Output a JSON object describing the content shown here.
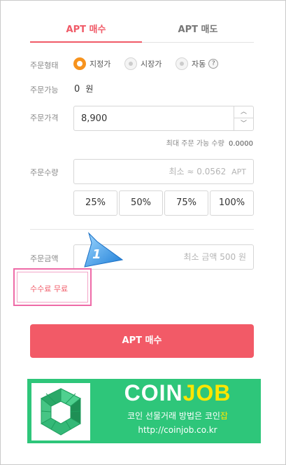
{
  "tabs": {
    "buy": "APT 매수",
    "sell": "APT 매도"
  },
  "order_type": {
    "label": "주문형태",
    "options": [
      "지정가",
      "시장가",
      "자동"
    ],
    "selected": "지정가",
    "help": "?"
  },
  "available": {
    "label": "주문가능",
    "value": "0",
    "unit": "원"
  },
  "price": {
    "label": "주문가격",
    "value": "8,900"
  },
  "max_qty": {
    "label": "최대 주문 가능 수량",
    "value": "0.0000"
  },
  "quantity": {
    "label": "주문수량",
    "placeholder": "최소 ≈ 0.0562",
    "unit": "APT"
  },
  "percent_buttons": [
    "25%",
    "50%",
    "75%",
    "100%"
  ],
  "amount": {
    "label": "주문금액",
    "placeholder": "최소 금액 500 원"
  },
  "fee": {
    "text": "수수료 무료"
  },
  "annotation": {
    "number": "1"
  },
  "buy_button": "APT 매수",
  "banner": {
    "title_part1": "COIN",
    "title_part2": "JOB",
    "subtitle_main": "코인 선물거래 방법은 코인",
    "subtitle_highlight": "잡",
    "url": "http://coinjob.co.kr"
  },
  "colors": {
    "accent": "#f05a67",
    "radio_selected": "#f7931e",
    "banner_bg": "#2ec67a",
    "banner_highlight": "#ffe600",
    "annotation_border": "#ee6aa7"
  },
  "icons": [
    "chevron-up-icon",
    "chevron-down-icon",
    "help-icon",
    "annotation-arrow-icon",
    "coinjob-logo-icon"
  ]
}
